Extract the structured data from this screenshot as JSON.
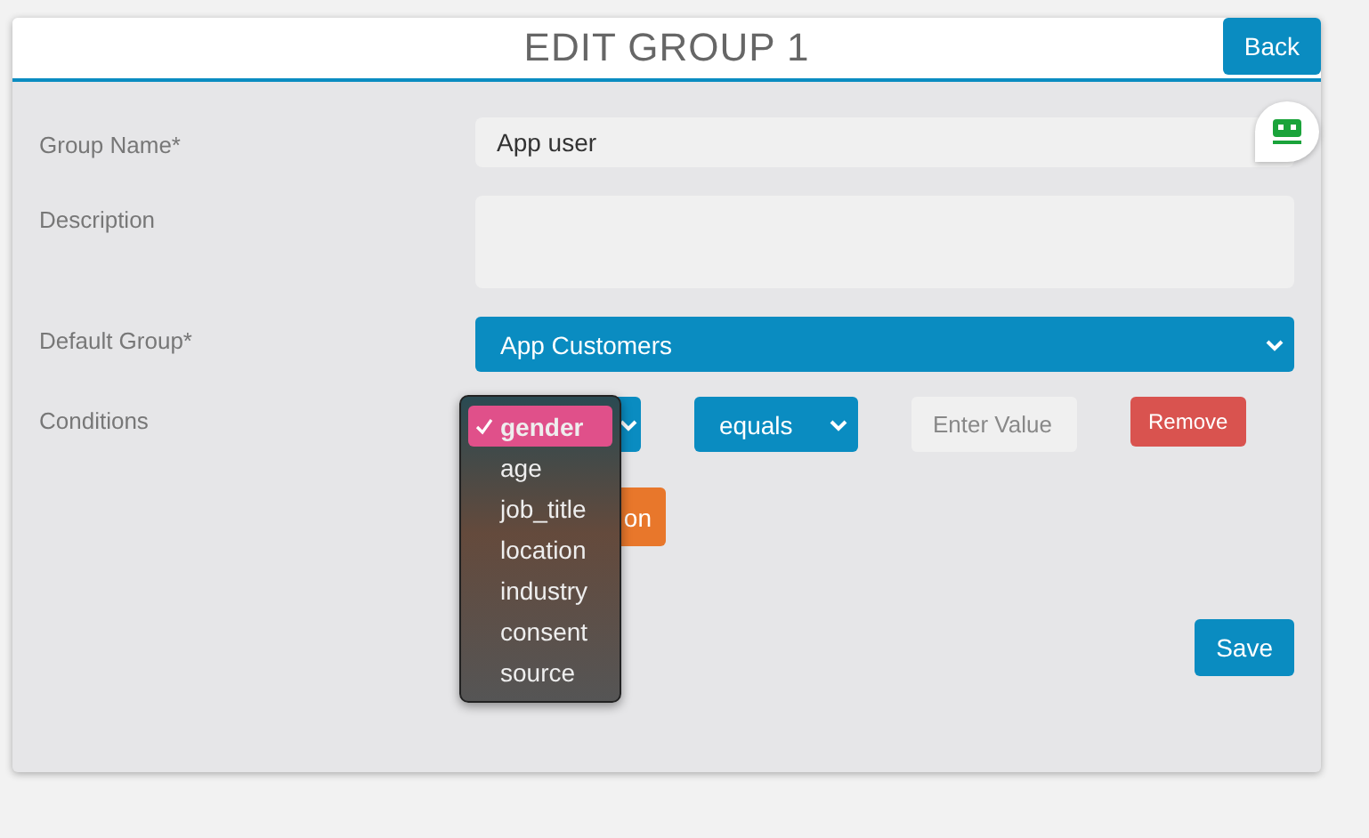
{
  "header": {
    "title": "EDIT GROUP 1",
    "back_button": "Back"
  },
  "form": {
    "group_name": {
      "label": "Group Name*",
      "value": "App user"
    },
    "description": {
      "label": "Description"
    },
    "default_group": {
      "label": "Default Group*",
      "value": "App Customers"
    },
    "conditions": {
      "label": "Conditions",
      "operator": "equals",
      "value_placeholder": "Enter Value",
      "remove_button": "Remove",
      "add_button": "on"
    }
  },
  "field_menu": {
    "options": [
      {
        "label": "gender",
        "selected": true
      },
      {
        "label": "age",
        "selected": false
      },
      {
        "label": "job_title",
        "selected": false
      },
      {
        "label": "location",
        "selected": false
      },
      {
        "label": "industry",
        "selected": false
      },
      {
        "label": "consent",
        "selected": false
      },
      {
        "label": "source",
        "selected": false
      }
    ]
  },
  "save_button": "Save"
}
